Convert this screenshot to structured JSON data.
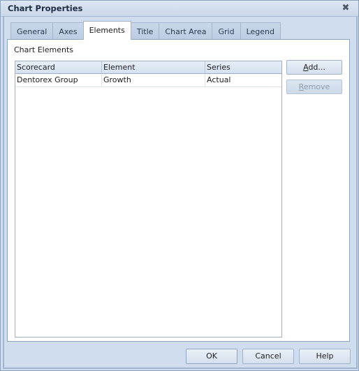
{
  "window": {
    "title": "Chart Properties",
    "close_icon": "close-x-icon"
  },
  "tabs": [
    {
      "label": "General",
      "active": false
    },
    {
      "label": "Axes",
      "active": false
    },
    {
      "label": "Elements",
      "active": true
    },
    {
      "label": "Title",
      "active": false
    },
    {
      "label": "Chart Area",
      "active": false
    },
    {
      "label": "Grid",
      "active": false
    },
    {
      "label": "Legend",
      "active": false
    }
  ],
  "elements_panel": {
    "group_label": "Chart Elements",
    "columns": [
      "Scorecard",
      "Element",
      "Series"
    ],
    "rows": [
      {
        "scorecard": "Dentorex Group",
        "element": "Growth",
        "series": "Actual"
      }
    ],
    "add_button": {
      "accel": "A",
      "rest": "dd...",
      "enabled": true
    },
    "remove_button": {
      "accel": "R",
      "rest": "emove",
      "enabled": false
    }
  },
  "footer": {
    "ok_label": "OK",
    "cancel_label": "Cancel",
    "help_label": "Help"
  }
}
